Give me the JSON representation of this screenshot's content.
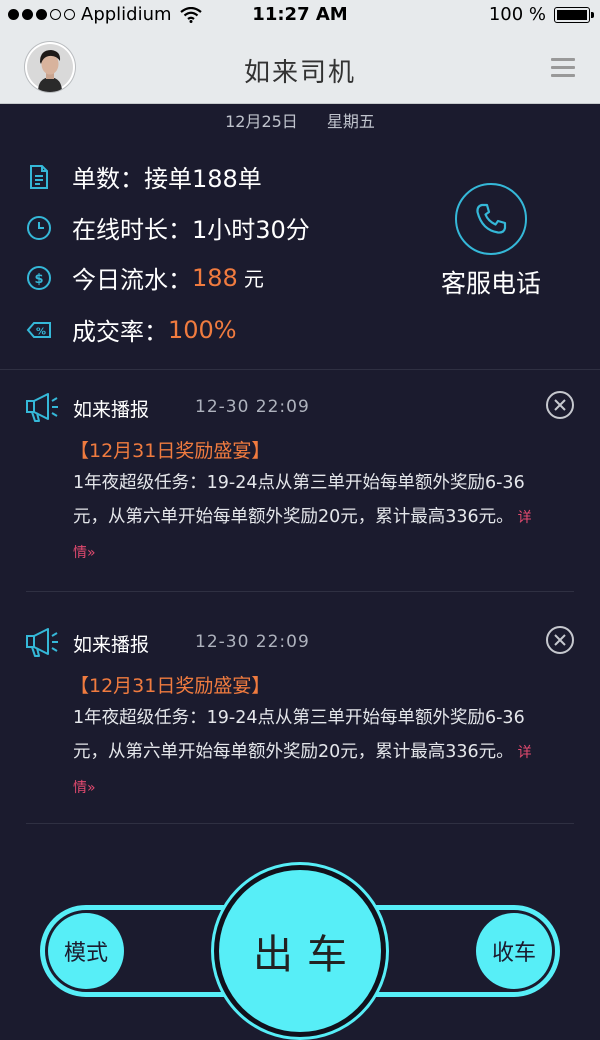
{
  "status_bar": {
    "carrier": "Applidium",
    "time": "11:27 AM",
    "battery": "100 %"
  },
  "nav": {
    "title": "如来司机"
  },
  "summary": {
    "date": "12月25日",
    "weekday": "星期五",
    "orders_label": "单数：",
    "orders_value": "接单188单",
    "online_label": "在线时长：",
    "online_value": "1小时30分",
    "revenue_label": "今日流水：",
    "revenue_value": "188",
    "revenue_unit": "元",
    "rate_label": "成交率：",
    "rate_value": "100%",
    "service_phone_label": "客服电话"
  },
  "broadcasts": [
    {
      "source": "如来播报",
      "time": "12-30 22:09",
      "title": "【12月31日奖励盛宴】",
      "body": "1年夜超级任务：19-24点从第三单开始每单额外奖励6-36元，从第六单开始每单额外奖励20元，累计最高336元。",
      "more": "详情»"
    },
    {
      "source": "如来播报",
      "time": "12-30 22:09",
      "title": "【12月31日奖励盛宴】",
      "body": "1年夜超级任务：19-24点从第三单开始每单额外奖励6-36元，从第六单开始每单额外奖励20元，累计最高336元。",
      "more": "详情»"
    }
  ],
  "controls": {
    "mode": "模式",
    "depart": "出车",
    "stop": "收车"
  },
  "colors": {
    "accent": "#57eef7",
    "highlight": "#f07b3f",
    "link": "#e24a6f",
    "background": "#1b1b2e",
    "icon": "#35b8d8"
  }
}
